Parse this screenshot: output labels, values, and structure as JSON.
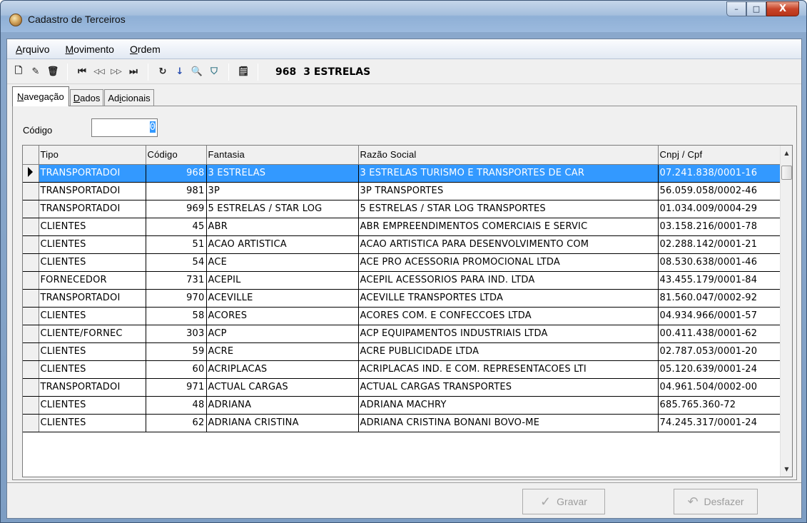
{
  "window": {
    "title": "Cadastro de Terceiros",
    "controls": {
      "minimize": "–",
      "maximize": "□",
      "close": "X"
    }
  },
  "menu": [
    {
      "key": "A",
      "rest": "rquivo"
    },
    {
      "key": "M",
      "rest": "ovimento"
    },
    {
      "key": "O",
      "rest": "rdem"
    }
  ],
  "toolbar": {
    "icons": [
      "new-doc",
      "edit-pen",
      "delete-trash",
      "first",
      "prior",
      "next",
      "last",
      "refresh",
      "sort-az",
      "find-binoculars",
      "filter-funnel",
      "properties"
    ],
    "glyphs": {
      "new": "🗋",
      "edit": "✎",
      "del": "🗑",
      "first": "⏮",
      "prior": "◁◁",
      "next": "▷▷",
      "last": "⏭",
      "refresh": "↻",
      "sort": "↓",
      "find": "🔍",
      "filter": "⛉",
      "props": "🗒"
    },
    "record_code": "968",
    "record_name": "3 ESTRELAS"
  },
  "tabs": [
    {
      "key": "N",
      "rest": "avegação"
    },
    {
      "key": "D",
      "rest": "ados"
    },
    {
      "pre": "Ad",
      "key": "i",
      "rest": "cionais"
    }
  ],
  "codigo": {
    "label": "Código",
    "value": "0"
  },
  "grid": {
    "columns": [
      "Tipo",
      "Código",
      "Fantasia",
      "Razão Social",
      "Cnpj / Cpf"
    ],
    "rows": [
      [
        "TRANSPORTADOI",
        "968",
        "3 ESTRELAS",
        "3 ESTRELAS TURISMO E TRANSPORTES DE CAR",
        "07.241.838/0001-16"
      ],
      [
        "TRANSPORTADOI",
        "981",
        "3P",
        "3P TRANSPORTES",
        "56.059.058/0002-46"
      ],
      [
        "TRANSPORTADOI",
        "969",
        "5 ESTRELAS / STAR LOG",
        "5 ESTRELAS / STAR LOG  TRANSPORTES",
        "01.034.009/0004-29"
      ],
      [
        "CLIENTES",
        "45",
        "ABR",
        "ABR EMPREENDIMENTOS COMERCIAIS E SERVIC",
        "03.158.216/0001-78"
      ],
      [
        "CLIENTES",
        "51",
        "ACAO ARTISTICA",
        "ACAO ARTISTICA PARA DESENVOLVIMENTO COM",
        "02.288.142/0001-21"
      ],
      [
        "CLIENTES",
        "54",
        "ACE",
        "ACE PRO ACESSORIA PROMOCIONAL LTDA",
        "08.530.638/0001-46"
      ],
      [
        "FORNECEDOR",
        "731",
        "ACEPIL",
        "ACEPIL ACESSORIOS PARA IND. LTDA",
        "43.455.179/0001-84"
      ],
      [
        "TRANSPORTADOI",
        "970",
        "ACEVILLE",
        "ACEVILLE TRANSPORTES LTDA",
        "81.560.047/0002-92"
      ],
      [
        "CLIENTES",
        "58",
        "ACORES",
        "ACORES COM. E CONFECCOES LTDA",
        "04.934.966/0001-57"
      ],
      [
        "CLIENTE/FORNEC",
        "303",
        "ACP",
        "ACP  EQUIPAMENTOS INDUSTRIAIS LTDA",
        "00.411.438/0001-62"
      ],
      [
        "CLIENTES",
        "59",
        "ACRE",
        "ACRE PUBLICIDADE LTDA",
        "02.787.053/0001-20"
      ],
      [
        "CLIENTES",
        "60",
        "ACRIPLACAS",
        "ACRIPLACAS IND. E COM. REPRESENTACOES LTI",
        "05.120.639/0001-24"
      ],
      [
        "TRANSPORTADOI",
        "971",
        "ACTUAL CARGAS",
        "ACTUAL CARGAS TRANSPORTES",
        "04.961.504/0002-00"
      ],
      [
        "CLIENTES",
        "48",
        "ADRIANA",
        "ADRIANA MACHRY",
        "685.765.360-72"
      ],
      [
        "CLIENTES",
        "62",
        "ADRIANA CRISTINA",
        "ADRIANA CRISTINA BONANI BOVO-ME",
        "74.245.317/0001-24"
      ]
    ],
    "selected_row": 0
  },
  "buttons": {
    "gravar": {
      "icon": "✓",
      "label": "Gravar"
    },
    "desfazer": {
      "icon": "↶",
      "label": "Desfazer"
    }
  }
}
